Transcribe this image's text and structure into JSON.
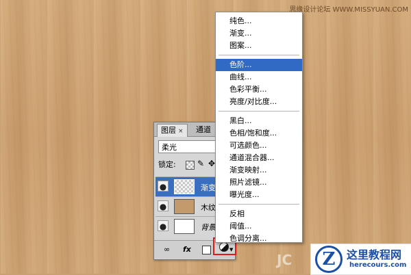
{
  "watermark": "思缘设计论坛 WWW.MISSYUAN.COM",
  "layers_panel": {
    "tabs": {
      "layers": "图层",
      "close": "×",
      "channels": "通道"
    },
    "blend_mode": "柔光",
    "lock_label": "锁定:",
    "layers": [
      {
        "name": "渐变",
        "selected": true,
        "thumbnail": "transparent-gradient"
      },
      {
        "name": "木纹",
        "selected": false,
        "thumbnail": "wood"
      },
      {
        "name": "背景",
        "selected": false,
        "thumbnail": "white"
      }
    ],
    "bottom_bar": {
      "fx": "fx"
    }
  },
  "adjust_menu": {
    "groups": [
      [
        "纯色...",
        "渐变...",
        "图案..."
      ],
      [
        "色阶...",
        "曲线...",
        "色彩平衡...",
        "亮度/对比度..."
      ],
      [
        "黑白...",
        "色相/饱和度...",
        "可选颜色...",
        "通道混合器...",
        "渐变映射...",
        "照片滤镜...",
        "曝光度..."
      ],
      [
        "反相",
        "阈值...",
        "色调分离..."
      ]
    ],
    "selected": "色阶..."
  },
  "logo": {
    "title": "这里教程网",
    "url": "herecours.com",
    "mark": "JC"
  },
  "colors": {
    "selection": "#316ac5",
    "highlight_box": "#e01a1a",
    "logo": "#1d4fa5"
  }
}
